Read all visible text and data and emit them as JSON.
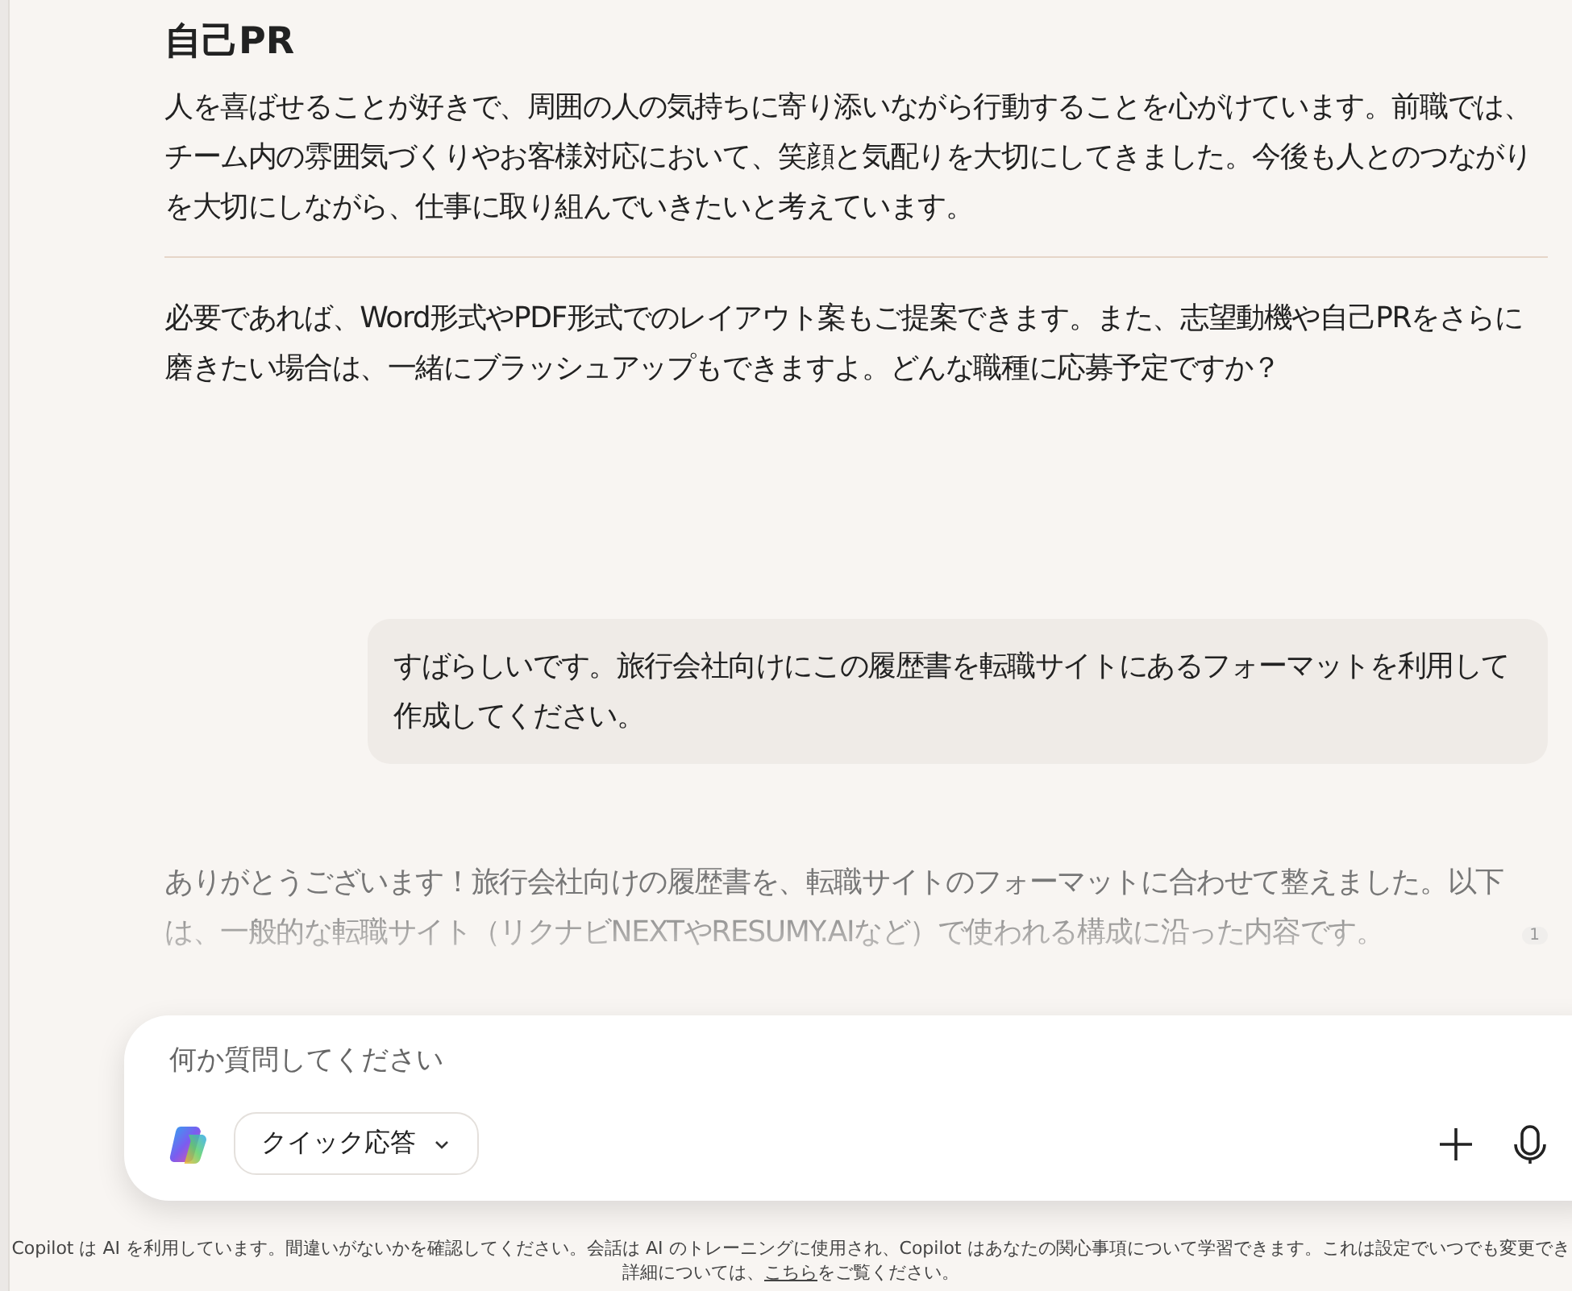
{
  "messages": [
    {
      "kind": "assistant",
      "heading": "自己PR",
      "paragraphs": [
        "人を喜ばせることが好きで、周囲の人の気持ちに寄り添いながら行動することを心がけています。前職では、チーム内の雰囲気づくりやお客様対応において、笑顔と気配りを大切にしてきました。今後も人とのつながりを大切にしながら、仕事に取り組んでいきたいと考えています。"
      ],
      "closing": "必要であれば、Word形式やPDF形式でのレイアウト案もご提案できます。また、志望動機や自己PRをさらに磨きたい場合は、一緒にブラッシュアップもできますよ。どんな職種に応募予定ですか？"
    },
    {
      "kind": "user",
      "text": "すばらしいです。旅行会社向けにこの履歴書を転職サイトにあるフォーマットを利用して作成してください。"
    },
    {
      "kind": "streaming",
      "text": "ありがとうございます！旅行会社向けの履歴書を、転職サイトのフォーマットに合わせて整えました。以下は、一般的な転職サイト（リクナビNEXTやRESUMY.AIなど）で使われる構成に沿った内容です。",
      "citation": "1"
    }
  ],
  "composer": {
    "placeholder": "何か質問してください",
    "mode": "クイック応答"
  },
  "footer": {
    "notice": "Copilot は AI を利用しています。間違いがないかを確認してください。会話は AI のトレーニングに使用され、Copilot はあなたの関心事項について学習できます。これは設定でいつでも変更でき",
    "detail_before": "詳細については、",
    "link": "こちら",
    "detail_after": "をご覧ください。"
  }
}
